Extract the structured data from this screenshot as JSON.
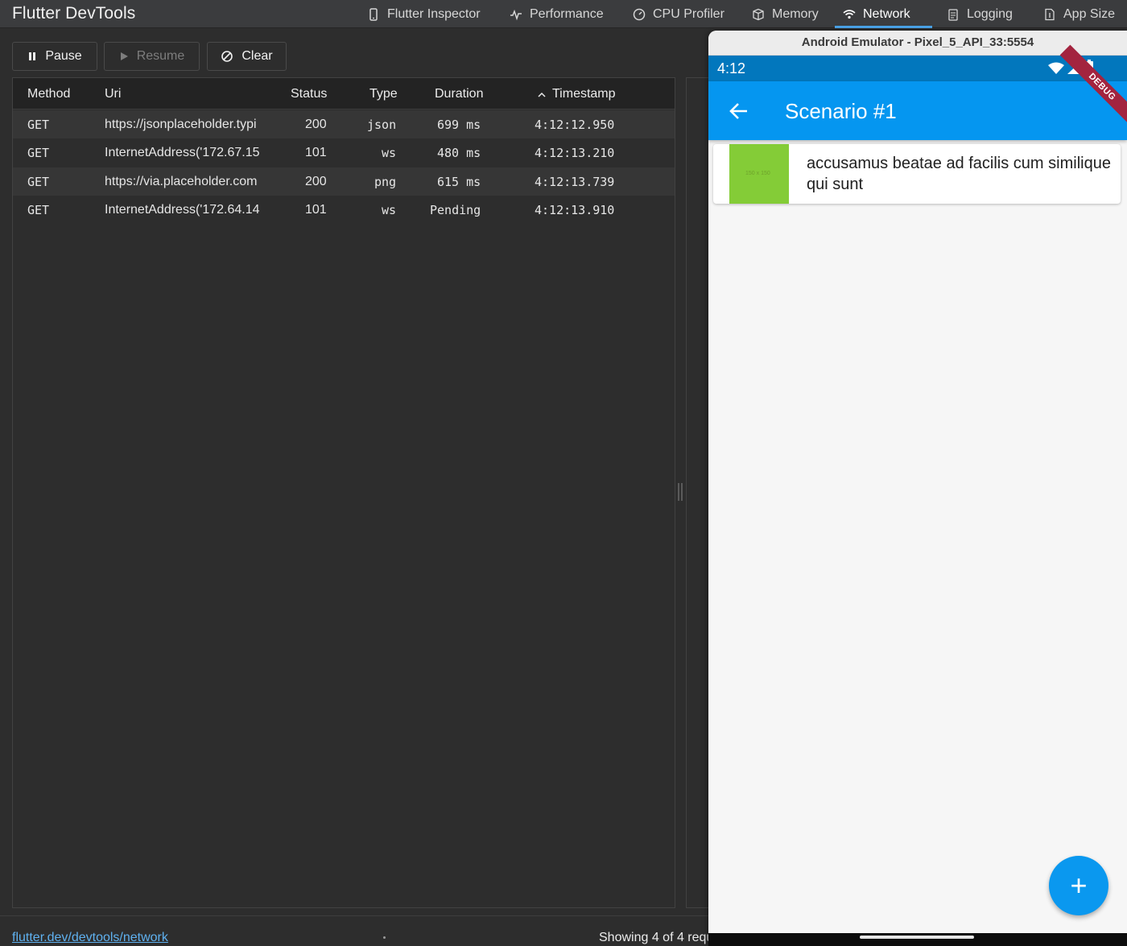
{
  "app": {
    "title": "Flutter DevTools"
  },
  "nav": {
    "tabs": [
      {
        "label": "Flutter Inspector",
        "icon": "phone-icon"
      },
      {
        "label": "Performance",
        "icon": "pulse-icon"
      },
      {
        "label": "CPU Profiler",
        "icon": "gauge-icon"
      },
      {
        "label": "Memory",
        "icon": "memory-icon"
      },
      {
        "label": "Network",
        "icon": "wifi-icon",
        "active": true
      },
      {
        "label": "Logging",
        "icon": "logging-icon"
      },
      {
        "label": "App Size",
        "icon": "app-size-icon"
      }
    ]
  },
  "toolbar": {
    "pause_label": "Pause",
    "resume_label": "Resume",
    "clear_label": "Clear"
  },
  "table": {
    "headers": {
      "method": "Method",
      "uri": "Uri",
      "status": "Status",
      "type": "Type",
      "duration": "Duration",
      "timestamp": "Timestamp"
    },
    "rows": [
      {
        "method": "GET",
        "uri": "https://jsonplaceholder.typi",
        "status": "200",
        "type": "json",
        "duration": "699 ms",
        "timestamp": "4:12:12.950"
      },
      {
        "method": "GET",
        "uri": "InternetAddress('172.67.15",
        "status": "101",
        "type": "ws",
        "duration": "480 ms",
        "timestamp": "4:12:13.210"
      },
      {
        "method": "GET",
        "uri": "https://via.placeholder.com",
        "status": "200",
        "type": "png",
        "duration": "615 ms",
        "timestamp": "4:12:13.739"
      },
      {
        "method": "GET",
        "uri": "InternetAddress('172.64.14",
        "status": "101",
        "type": "ws",
        "duration": "Pending",
        "timestamp": "4:12:13.910"
      }
    ]
  },
  "statusbar": {
    "link": "flutter.dev/devtools/network",
    "count": "Showing 4 of 4 requ"
  },
  "emulator": {
    "window_title": "Android Emulator - Pixel_5_API_33:5554",
    "time": "4:12",
    "debug_banner": "DEBUG",
    "appbar_title": "Scenario #1",
    "card_text": "accusamus beatae ad facilis cum similique qui sunt",
    "thumb_text": "150 x 150",
    "fab_label": "+"
  },
  "colors": {
    "accent": "#4aa3e8",
    "appbar": "#0596f0",
    "status": "#0277bd",
    "thumb": "#84cc37",
    "debug": "#a3243f"
  }
}
